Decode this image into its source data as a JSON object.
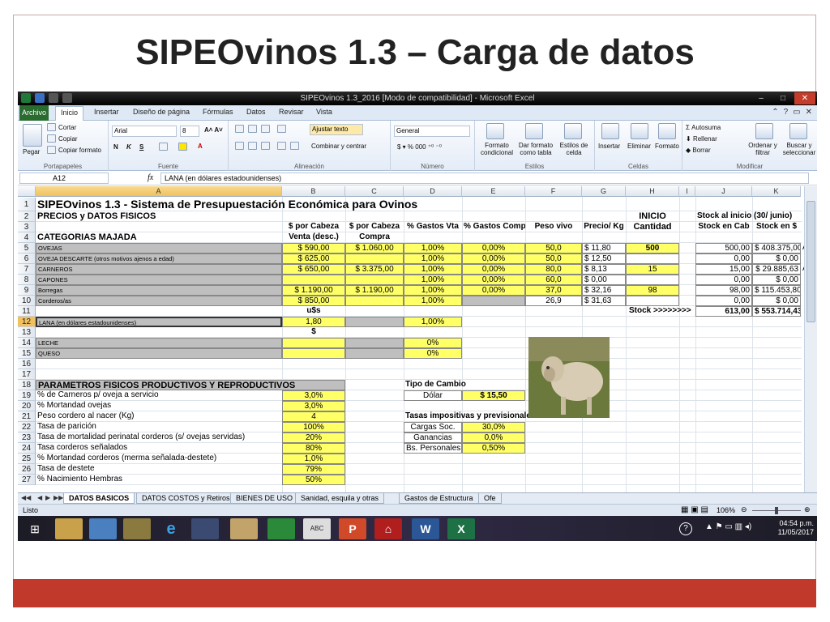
{
  "slide": {
    "title": "SIPEOvinos 1.3 – Carga de datos"
  },
  "window": {
    "title": "SIPEOvinos 1.3_2016  [Modo de compatibilidad] - Microsoft Excel",
    "controls": [
      "–",
      "□",
      "✕"
    ]
  },
  "ribbon": {
    "tabs": [
      "Archivo",
      "Inicio",
      "Insertar",
      "Diseño de página",
      "Fórmulas",
      "Datos",
      "Revisar",
      "Vista"
    ],
    "clipboard": {
      "paste": "Pegar",
      "cut": "Cortar",
      "copy": "Copiar",
      "format_painter": "Copiar formato",
      "label": "Portapapeles"
    },
    "font": {
      "name": "Arial",
      "size": "8",
      "bold": "N",
      "italic": "K",
      "underline": "S",
      "label": "Fuente"
    },
    "alignment": {
      "wrap": "Ajustar texto",
      "merge": "Combinar y centrar",
      "label": "Alineación"
    },
    "number": {
      "format": "General",
      "label": "Número"
    },
    "styles": {
      "cond": "Formato condicional",
      "table": "Dar formato como tabla",
      "cell": "Estilos de celda",
      "label": "Estilos"
    },
    "cells": {
      "insert": "Insertar",
      "delete": "Eliminar",
      "format": "Formato",
      "label": "Celdas"
    },
    "editing": {
      "autosum": "Autosuma",
      "fill": "Rellenar",
      "clear": "Borrar",
      "sort": "Ordenar y filtrar",
      "find": "Buscar y seleccionar",
      "label": "Modificar"
    }
  },
  "formula_bar": {
    "name_box": "A12",
    "fx": "fx",
    "formula": "LANA (en dólares estadounidenses)"
  },
  "columns": [
    "A",
    "B",
    "C",
    "D",
    "E",
    "F",
    "G",
    "H",
    "I",
    "J",
    "K"
  ],
  "rows": [
    "1",
    "2",
    "3",
    "4",
    "5",
    "6",
    "7",
    "8",
    "9",
    "10",
    "11",
    "12",
    "13",
    "14",
    "15",
    "16",
    "17",
    "18",
    "19",
    "20",
    "21",
    "22",
    "23",
    "24",
    "25",
    "26",
    "27"
  ],
  "sheet": {
    "r1": "SIPEOvinos 1.3 - Sistema de Presupuestación Económica para Ovinos",
    "r2": "PRECIOS y DATOS FISICOS",
    "inicio": "INICIO",
    "stock_inicio": "Stock al inicio (30/ junio)",
    "hdr_b3": "$ por Cabeza",
    "hdr_c3": "$ por Cabeza",
    "hdr_d3": "% Gastos Vta",
    "hdr_e3": "% Gastos Compra",
    "hdr_f3": "Peso vivo",
    "hdr_g3": "Precio/ Kg",
    "hdr_h3": "Cantidad",
    "hdr_j3": "Stock en Cab",
    "hdr_k3": "Stock en $",
    "r4_a": "CATEGORIAS MAJADA",
    "hdr_b4": "Venta (desc.)",
    "hdr_c4": "Compra",
    "data": [
      {
        "a": "OVEJAS",
        "b": "$ 590,00",
        "c": "$ 1.060,00",
        "d": "1,00%",
        "e": "0,00%",
        "f": "50,0",
        "g": "$ 11,80",
        "h": "500",
        "j": "500,00",
        "k": "$ 408.375,00",
        "extra": "A v"
      },
      {
        "a": "OVEJA DESCARTE (otros motivos ajenos a edad)",
        "b": "$ 625,00",
        "c": "",
        "d": "1,00%",
        "e": "0,00%",
        "f": "50,0",
        "g": "$ 12,50",
        "h": "",
        "j": "0,00",
        "k": "$ 0,00",
        "extra": ""
      },
      {
        "a": "CARNEROS",
        "b": "$ 650,00",
        "c": "$ 3.375,00",
        "d": "1,00%",
        "e": "0,00%",
        "f": "80,0",
        "g": "$ 8,13",
        "h": "15",
        "j": "15,00",
        "k": "$ 29.885,63",
        "extra": "A v"
      },
      {
        "a": "CAPONES",
        "b": "",
        "c": "",
        "d": "1,00%",
        "e": "0,00%",
        "f": "60,0",
        "g": "$ 0,00",
        "h": "",
        "j": "0,00",
        "k": "$ 0,00",
        "extra": ""
      },
      {
        "a": "Borregas",
        "b": "$ 1.190,00",
        "c": "$ 1.190,00",
        "d": "1,00%",
        "e": "0,00%",
        "f": "37,0",
        "g": "$ 32,16",
        "h": "98",
        "j": "98,00",
        "k": "$ 115.453,80",
        "extra": ""
      },
      {
        "a": "Corderos/as",
        "b": "$ 850,00",
        "c": "",
        "d": "1,00%",
        "e": "",
        "f": "26,9",
        "g": "$ 31,63",
        "h": "",
        "j": "0,00",
        "k": "$ 0,00",
        "extra": ""
      }
    ],
    "r11_b": "u$s",
    "r11_stock_label": "Stock >>>>>>>>",
    "r11_j": "613,00",
    "r11_k": "$ 553.714,43",
    "r12_a": "LANA (en dólares estadounidenses)",
    "r12_b": "1,80",
    "r12_d": "1,00%",
    "r13_b": "$",
    "r14_a": "LECHE",
    "r14_d": "0%",
    "r15_a": "QUESO",
    "r15_d": "0%",
    "r18_a": "PARAMETROS FISICOS PRODUCTIVOS Y REPRODUCTIVOS",
    "tipo_cambio": "Tipo de Cambio",
    "dolar_label": "Dólar",
    "dolar_value": "$ 15,50",
    "tasas": "Tasas impositivas y previsionales",
    "params": [
      {
        "label": "% de Carneros p/ oveja a servicio",
        "value": "3,0%"
      },
      {
        "label": "% Mortandad ovejas",
        "value": "3,0%"
      },
      {
        "label": "Peso cordero al nacer (Kg)",
        "value": "4"
      },
      {
        "label": "Tasa de parición",
        "value": "100%"
      },
      {
        "label": "Tasa de mortalidad perinatal corderos (s/ ovejas servidas)",
        "value": "20%"
      },
      {
        "label": "Tasa corderos señalados",
        "value": "80%"
      },
      {
        "label": "% Mortandad corderos (merma señalada-destete)",
        "value": "1,0%"
      },
      {
        "label": "Tasa de destete",
        "value": "79%"
      },
      {
        "label": "% Nacimiento Hembras",
        "value": "50%"
      }
    ],
    "tax": [
      {
        "label": "Cargas Soc.",
        "value": "30,0%"
      },
      {
        "label": "Ganancias",
        "value": "0,0%"
      },
      {
        "label": "Bs. Personales",
        "value": "0,50%"
      }
    ]
  },
  "sheet_tabs": [
    "DATOS BASICOS",
    "DATOS COSTOS y Retiros",
    "BIENES DE USO",
    "Sanidad, esquila y otras",
    "Gastos de Estructura",
    "Ofe"
  ],
  "status": {
    "ready": "Listo",
    "zoom": "106%"
  },
  "taskbar": {
    "time": "04:54 p.m.",
    "date": "11/05/2017"
  }
}
